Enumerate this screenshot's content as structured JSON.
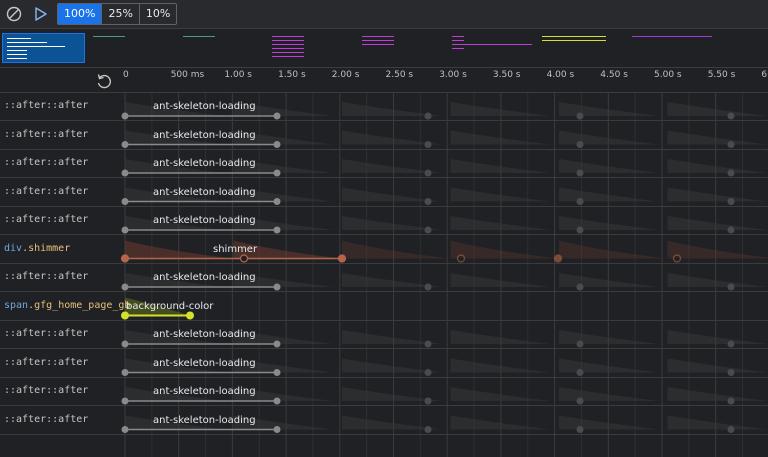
{
  "toolbar": {
    "clear_icon": "clear-icon",
    "play_icon": "play-icon",
    "speeds": [
      {
        "label": "100%",
        "active": true
      },
      {
        "label": "25%",
        "active": false
      },
      {
        "label": "10%",
        "active": false
      }
    ]
  },
  "timeline": {
    "replay_icon": "replay-icon",
    "ticks": [
      "0",
      "500 ms",
      "1.00 s",
      "1.50 s",
      "2.00 s",
      "2.50 s",
      "3.00 s",
      "3.50 s",
      "4.00 s",
      "4.50 s",
      "5.00 s",
      "5.50 s",
      "6"
    ]
  },
  "rows": [
    {
      "tag": "",
      "cls": "",
      "pseudo": "::after::after",
      "animation": "ant-skeleton-loading",
      "color": "#8a8a8a",
      "kind": "skeleton"
    },
    {
      "tag": "",
      "cls": "",
      "pseudo": "::after::after",
      "animation": "ant-skeleton-loading",
      "color": "#8a8a8a",
      "kind": "skeleton"
    },
    {
      "tag": "",
      "cls": "",
      "pseudo": "::after::after",
      "animation": "ant-skeleton-loading",
      "color": "#8a8a8a",
      "kind": "skeleton"
    },
    {
      "tag": "",
      "cls": "",
      "pseudo": "::after::after",
      "animation": "ant-skeleton-loading",
      "color": "#8a8a8a",
      "kind": "skeleton"
    },
    {
      "tag": "",
      "cls": "",
      "pseudo": "::after::after",
      "animation": "ant-skeleton-loading",
      "color": "#8a8a8a",
      "kind": "skeleton"
    },
    {
      "tag": "div",
      "cls": ".shimmer",
      "pseudo": "",
      "animation": "shimmer",
      "color": "#b5654a",
      "kind": "shimmer"
    },
    {
      "tag": "",
      "cls": "",
      "pseudo": "::after::after",
      "animation": "ant-skeleton-loading",
      "color": "#8a8a8a",
      "kind": "skeleton"
    },
    {
      "tag": "span",
      "cls": ".gfg_home_page_gb",
      "pseudo": "",
      "animation": "background-color",
      "color": "#d4e02a",
      "kind": "bg"
    },
    {
      "tag": "",
      "cls": "",
      "pseudo": "::after::after",
      "animation": "ant-skeleton-loading",
      "color": "#8a8a8a",
      "kind": "skeleton"
    },
    {
      "tag": "",
      "cls": "",
      "pseudo": "::after::after",
      "animation": "ant-skeleton-loading",
      "color": "#8a8a8a",
      "kind": "skeleton"
    },
    {
      "tag": "",
      "cls": "",
      "pseudo": "::after::after",
      "animation": "ant-skeleton-loading",
      "color": "#8a8a8a",
      "kind": "skeleton"
    },
    {
      "tag": "",
      "cls": "",
      "pseudo": "::after::after",
      "animation": "ant-skeleton-loading",
      "color": "#8a8a8a",
      "kind": "skeleton"
    }
  ],
  "overview": {
    "groups": [
      {
        "color": "#ffffff",
        "selected": true
      },
      {
        "color": "#4a9c7a",
        "selected": false
      },
      {
        "color": "#4a9c7a",
        "selected": false
      },
      {
        "color": "#c03ed8",
        "selected": false
      },
      {
        "color": "#c03ed8",
        "selected": false
      },
      {
        "color": "#c03ed8",
        "selected": false
      },
      {
        "color": "#d4e02a",
        "selected": false
      },
      {
        "color": "#9c3ed8",
        "selected": false
      }
    ]
  }
}
